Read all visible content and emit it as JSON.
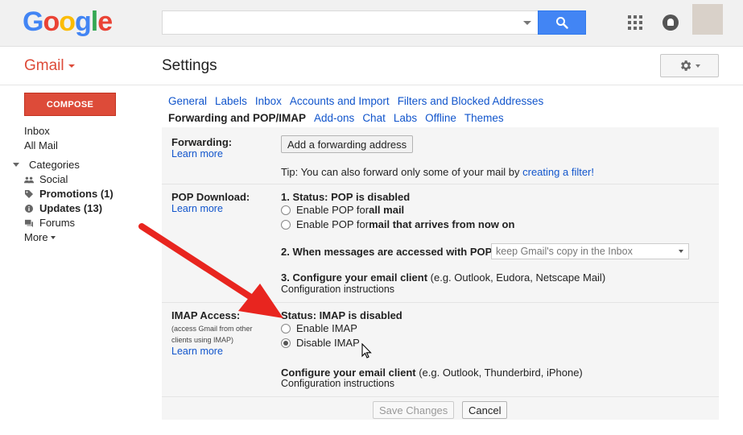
{
  "header": {
    "logo_letters": [
      {
        "ch": "G",
        "color": "#4285F4"
      },
      {
        "ch": "o",
        "color": "#EA4335"
      },
      {
        "ch": "o",
        "color": "#FBBC05"
      },
      {
        "ch": "g",
        "color": "#4285F4"
      },
      {
        "ch": "l",
        "color": "#34A853"
      },
      {
        "ch": "e",
        "color": "#EA4335"
      }
    ],
    "search_value": "",
    "search_button_icon": "search-icon",
    "apps_icon": "apps-grid-icon",
    "notifications_icon": "notifications-icon"
  },
  "app": {
    "name": "Gmail",
    "page_title": "Settings",
    "brand_color": "#dd4b39",
    "link_color": "#1155cc"
  },
  "nav": {
    "compose_label": "COMPOSE",
    "inbox": "Inbox",
    "all_mail": "All Mail",
    "categories": "Categories",
    "social": "Social",
    "promotions": "Promotions (1)",
    "updates": "Updates (13)",
    "forums": "Forums",
    "more": "More"
  },
  "tabs": {
    "row1": [
      "General",
      "Labels",
      "Inbox",
      "Accounts and Import",
      "Filters and Blocked Addresses"
    ],
    "row2": [
      "Forwarding and POP/IMAP",
      "Add-ons",
      "Chat",
      "Labs",
      "Offline",
      "Themes"
    ],
    "active": "Forwarding and POP/IMAP"
  },
  "forwarding": {
    "label": "Forwarding:",
    "learn_more": "Learn more",
    "add_button": "Add a forwarding address",
    "tip_prefix": "Tip: You can also forward only some of your mail by ",
    "tip_link": "creating a filter!"
  },
  "pop": {
    "label": "POP Download:",
    "learn_more": "Learn more",
    "status": "1. Status: POP is disabled",
    "opt1_prefix": "Enable POP for ",
    "opt1_bold": "all mail",
    "opt2_prefix": "Enable POP for ",
    "opt2_bold": "mail that arrives from now on",
    "step2": "2. When messages are accessed with POP",
    "step2_select": "keep Gmail's copy in the Inbox",
    "step3_bold": "3. Configure your email client",
    "step3_rest": " (e.g. Outlook, Eudora, Netscape Mail)",
    "config_link": "Configuration instructions"
  },
  "imap": {
    "label": "IMAP Access:",
    "sub1": "(access Gmail from other",
    "sub2": "clients using IMAP)",
    "learn_more": "Learn more",
    "status": "Status: IMAP is disabled",
    "enable": "Enable IMAP",
    "disable": "Disable IMAP",
    "selected": "disable",
    "config_bold": "Configure your email client",
    "config_rest": " (e.g. Outlook, Thunderbird, iPhone)",
    "config_link": "Configuration instructions"
  },
  "footer": {
    "save": "Save Changes",
    "cancel": "Cancel"
  }
}
